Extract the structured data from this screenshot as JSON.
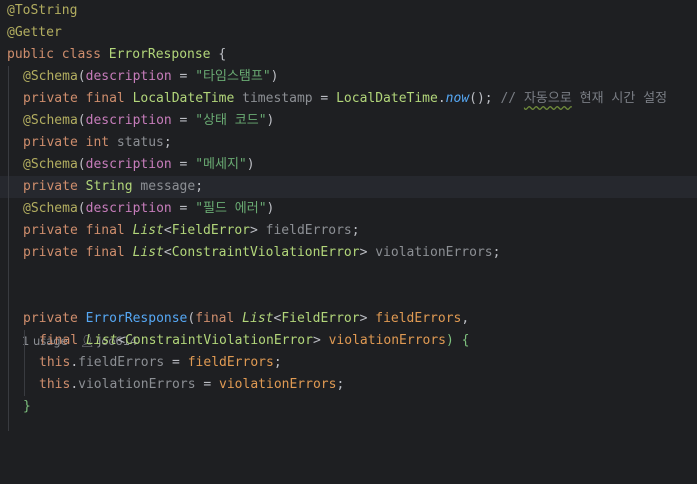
{
  "lines": {
    "l1": {
      "annotation": "@ToString"
    },
    "l2": {
      "annotation": "@Getter"
    },
    "l3": {
      "kw": "public class",
      "name": "ErrorResponse",
      "brace": " {"
    },
    "l4": {
      "annotation": "@Schema",
      "open": "(",
      "attr": "description",
      "eq": " = ",
      "value": "\"타임스탬프\"",
      "close": ")"
    },
    "l5": {
      "kw": "private final",
      "type": "LocalDateTime",
      "field": "timestamp",
      "eq": " = ",
      "cls": "LocalDateTime",
      "dot": ".",
      "method": "now",
      "call": "();",
      "comment_prefix": " // ",
      "comment_typo": "자동으로",
      "comment_rest": " 현재 시간 설정"
    },
    "l6": {
      "annotation": "@Schema",
      "open": "(",
      "attr": "description",
      "eq": " = ",
      "value": "\"상태 코드\"",
      "close": ")"
    },
    "l7": {
      "kw": "private int",
      "field": "status",
      "semi": ";"
    },
    "l8": {
      "annotation": "@Schema",
      "open": "(",
      "attr": "description",
      "eq": " = ",
      "value": "\"메세지\"",
      "close": ")"
    },
    "l9": {
      "kw": "private",
      "type": "String",
      "field": "message",
      "semi": ";"
    },
    "l10": {
      "annotation": "@Schema",
      "open": "(",
      "attr": "description",
      "eq": " = ",
      "value": "\"필드 에러\"",
      "close": ")"
    },
    "l11": {
      "kw": "private final",
      "iface": "List",
      "lt": "<",
      "type": "FieldError",
      "gt": ">",
      "field": "fieldErrors",
      "semi": ";"
    },
    "l12": {
      "kw": "private final",
      "iface": "List",
      "lt": "<",
      "type": "ConstraintViolationError",
      "gt": ">",
      "field": "violationErrors",
      "semi": ";"
    },
    "l13": {
      "kw": "private",
      "name": "ErrorResponse",
      "open": "(",
      "kw2": "final",
      "iface": "List",
      "lt": "<",
      "type": "FieldError",
      "gt": ">",
      "param": "fieldErrors",
      "comma": ","
    },
    "l14": {
      "kw": "final",
      "iface": "List",
      "lt": "<",
      "type": "ConstraintViolationError",
      "gt": ">",
      "param": "violationErrors",
      "close": ") {"
    },
    "l15": {
      "kw": "this",
      "dot": ".",
      "field": "fieldErrors",
      "eq": " = ",
      "param": "fieldErrors",
      "semi": ";"
    },
    "l16": {
      "kw": "this",
      "dot": ".",
      "field": "violationErrors",
      "eq": " = ",
      "param": "violationErrors",
      "semi": ";"
    },
    "l17": {
      "brace": "}"
    }
  },
  "inlay_hint": {
    "usages": "1 usage",
    "author": "Joo614"
  },
  "colors": {
    "background": "#1e1f22",
    "keyword": "#cf8e6d",
    "annotation": "#b3ae60",
    "string": "#6aab73",
    "field": "#c77dbb",
    "type": "#b2d67a"
  }
}
